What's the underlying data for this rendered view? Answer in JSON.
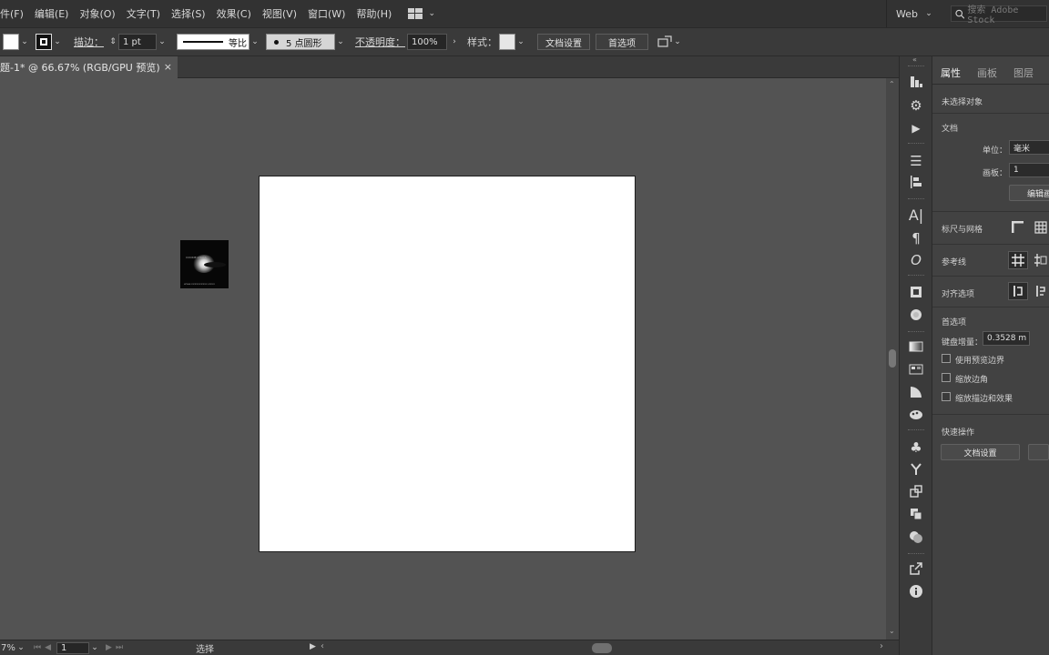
{
  "menubar": {
    "items": [
      "件(F)",
      "编辑(E)",
      "对象(O)",
      "文字(T)",
      "选择(S)",
      "效果(C)",
      "视图(V)",
      "窗口(W)",
      "帮助(H)"
    ],
    "workspace": "Web",
    "search_placeholder": "搜索 Adobe Stock"
  },
  "controlbar": {
    "stroke_label": "描边：",
    "stroke_weight": "1 pt",
    "profile_label": "等比",
    "brush_label": "5 点圆形",
    "opacity_label": "不透明度：",
    "opacity_value": "100%",
    "style_label": "样式：",
    "doc_setup_button": "文档设置",
    "prefs_button": "首选项"
  },
  "document_tab": {
    "title": "题-1* @ 66.67% (RGB/GPU 预览)",
    "close": "×"
  },
  "statusbar": {
    "zoom": "7%",
    "artboard_number": "1",
    "tool_name": "选择"
  },
  "panel": {
    "tabs": [
      "属性",
      "画板",
      "图层"
    ],
    "no_selection": "未选择对象",
    "document_section": "文档",
    "units_label": "单位：",
    "units_value": "毫米",
    "artboard_label": "画板：",
    "artboard_value": "1",
    "edit_artboard_button": "编辑画",
    "rulers_grid_label": "标尺与网格",
    "guides_label": "参考线",
    "snap_label": "对齐选项",
    "prefs_section": "首选项",
    "keyboard_increment_label": "键盘增量：",
    "keyboard_increment_value": "0.3528 m",
    "checkbox_preview_bounds": "使用预览边界",
    "checkbox_scale_corners": "缩放边角",
    "checkbox_scale_strokes": "缩放描边和效果",
    "quick_actions_section": "快速操作",
    "quick_doc_setup_button": "文档设置"
  },
  "thumbnail": {
    "line1": "COOKIE LYRICS",
    "line2": "www.xxxxxxxxxx.xxxx"
  }
}
